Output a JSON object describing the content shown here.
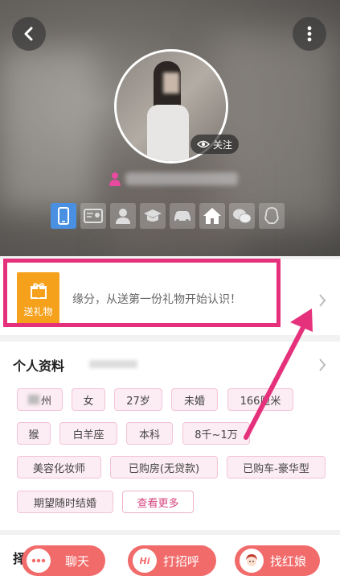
{
  "header": {
    "follow_label": "关注"
  },
  "gift": {
    "box_label": "送礼物",
    "text": "缘分，从送第一份礼物开始认识！"
  },
  "profile": {
    "title": "个人资料",
    "tags": [
      "州",
      "女",
      "27岁",
      "未婚",
      "166厘米",
      "猴",
      "白羊座",
      "本科",
      "8千~1万",
      "美容化妆师",
      "已购房(无贷款)",
      "已购车-豪华型",
      "期望随时结婚"
    ],
    "more_label": "查看更多"
  },
  "bottom": {
    "partial_title": "择",
    "chat_label": "聊天",
    "greet_label": "打招呼",
    "greet_icon_text": "Hi",
    "matchmaker_label": "找红娘"
  },
  "colors": {
    "highlight": "#e5317c",
    "gift": "#f5a11c",
    "pill": "#f26b6b",
    "verified": "#4a90e2"
  },
  "icons": [
    "back-arrow-icon",
    "more-vertical-icon",
    "eye-icon",
    "person-icon",
    "phone-icon",
    "id-card-icon",
    "avatar-icon",
    "education-icon",
    "car-icon",
    "house-icon",
    "wechat-icon",
    "qq-icon",
    "gift-icon",
    "chevron-right-icon",
    "chat-icon",
    "matchmaker-icon"
  ]
}
